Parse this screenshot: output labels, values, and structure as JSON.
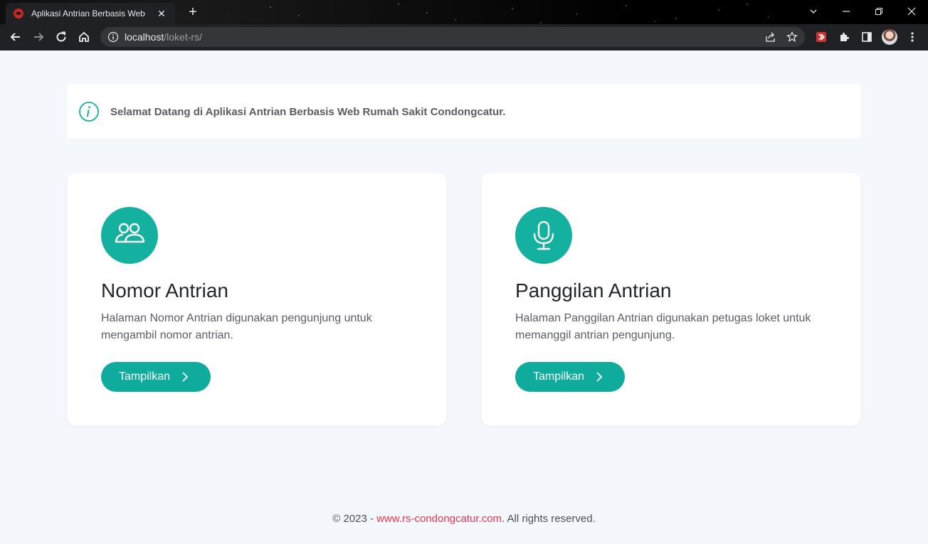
{
  "browser": {
    "tab_title": "Aplikasi Antrian Berbasis Web",
    "url_host": "localhost",
    "url_path": "/loket-rs/"
  },
  "alert": {
    "text": "Selamat Datang di Aplikasi Antrian Berbasis Web Rumah Sakit Condongcatur."
  },
  "cards": [
    {
      "icon": "users-icon",
      "title": "Nomor Antrian",
      "description": "Halaman Nomor Antrian digunakan pengunjung untuk mengambil nomor antrian.",
      "button_label": "Tampilkan"
    },
    {
      "icon": "microphone-icon",
      "title": "Panggilan Antrian",
      "description": "Halaman Panggilan Antrian digunakan petugas loket untuk memanggil antrian pengunjung.",
      "button_label": "Tampilkan"
    }
  ],
  "footer": {
    "prefix": "© 2023 - ",
    "link_text": "www.rs-condongcatur.com",
    "suffix": ". All rights reserved."
  },
  "colors": {
    "accent": "#0fab9c",
    "link": "#e4374f",
    "page_bg": "#f4f7fb"
  }
}
